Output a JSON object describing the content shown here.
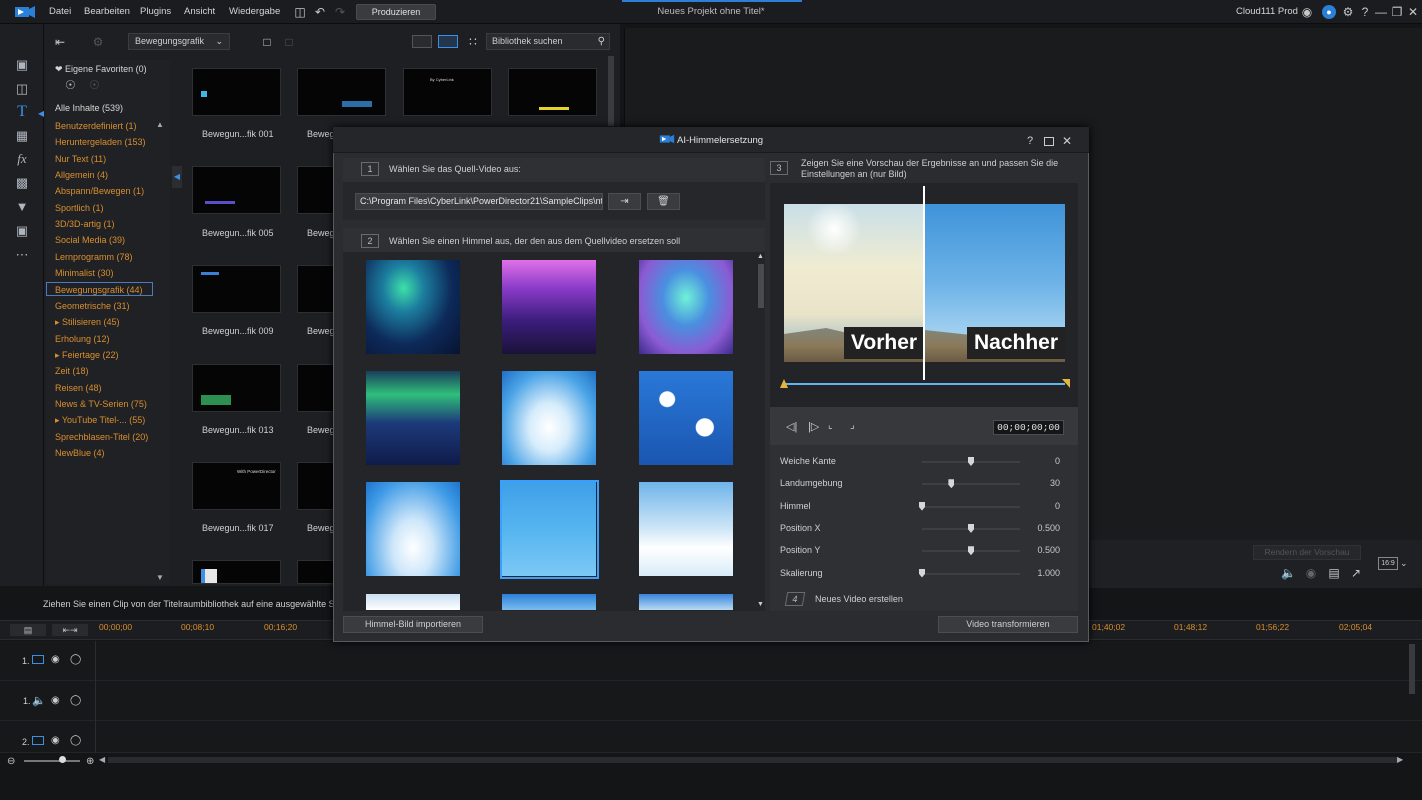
{
  "menu": {
    "items": [
      "Datei",
      "Bearbeiten",
      "Plugins",
      "Ansicht",
      "Wiedergabe"
    ],
    "produce_label": "Produzieren",
    "project_title": "Neues Projekt ohne Titel*",
    "user": "Cloud111 Prod"
  },
  "library": {
    "category_dropdown": "Bewegungsgrafik",
    "search_placeholder": "Bibliothek suchen",
    "favorites_label": "Eigene Favoriten (0)",
    "all_content": "Alle Inhalte (539)",
    "categories": [
      "Benutzerdefiniert  (1)",
      "Heruntergeladen  (153)",
      "Nur Text  (11)",
      "Allgemein  (4)",
      "Abspann/Bewegen  (1)",
      "Sportlich  (1)",
      "3D/3D-artig  (1)",
      "Social Media  (39)",
      "Lernprogramm  (78)",
      "Minimalist  (30)",
      "Bewegungsgrafik  (44)",
      "Geometrische  (31)",
      "▸ Stilisieren  (45)",
      "Erholung  (12)",
      "▸ Feiertage  (22)",
      "Zeit  (18)",
      "Reisen  (48)",
      "News & TV-Serien  (75)",
      "▸ YouTube Titel-...  (55)",
      "Sprechblasen-Titel  (20)",
      "NewBlue  (4)"
    ],
    "thumb_labels": [
      "Bewegun...fik 001",
      "Bewegun...fik 005",
      "Bewegun...fik 009",
      "Bewegun...fik 013",
      "Bewegun...fik 017"
    ],
    "thumb_label_partial": "Beweg",
    "thumb_texts": {
      "t2": "By CyberLink",
      "t3": "With PowerDirector"
    }
  },
  "dialog": {
    "title": "AI-Himmelersetzung",
    "step1_num": "1",
    "step1": "Wählen Sie das Quell-Video aus:",
    "source_path": "C:\\Program Files\\CyberLink\\PowerDirector21\\SampleClips\\nt",
    "step2_num": "2",
    "step2": "Wählen Sie einen Himmel aus, der den aus dem Quellvideo ersetzen soll",
    "step3_num": "3",
    "step3": "Zeigen Sie eine Vorschau der Ergebnisse an und passen Sie die Einstellungen an (nur Bild)",
    "before": "Vorher",
    "after": "Nachher",
    "timecode": "00;00;00;00",
    "sliders": [
      {
        "label": "Weiche Kante",
        "value": "0",
        "pos": 0.5
      },
      {
        "label": "Landumgebung",
        "value": "30",
        "pos": 0.3
      },
      {
        "label": "Himmel",
        "value": "0",
        "pos": 0.0
      },
      {
        "label": "Position X",
        "value": "0.500",
        "pos": 0.5
      },
      {
        "label": "Position Y",
        "value": "0.500",
        "pos": 0.5
      },
      {
        "label": "Skalierung",
        "value": "1.000",
        "pos": 0.0
      }
    ],
    "step4_num": "4",
    "step4": "Neues Video erstellen",
    "import_button": "Himmel-Bild importieren",
    "transform_button": "Video transformieren",
    "render_preview": "Rendern der Vorschau",
    "aspect": "16:9"
  },
  "timeline": {
    "hint": "Ziehen Sie einen Clip von der Titelraumbibliothek auf eine ausgewählte Sp",
    "ticks_left": [
      "00;00;00",
      "00;08;10",
      "00;16;20"
    ],
    "ticks_right": [
      "01;40;02",
      "01;48;12",
      "01;56;22",
      "02;05;04"
    ],
    "tracks": [
      "1.",
      "1.",
      "2."
    ]
  }
}
